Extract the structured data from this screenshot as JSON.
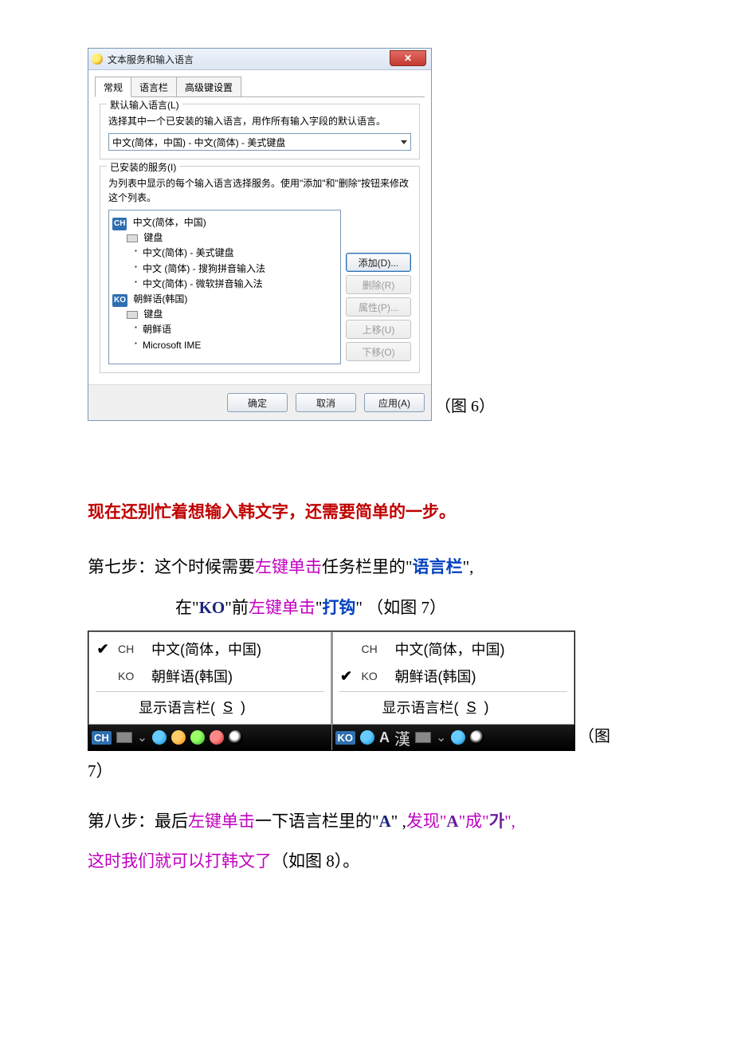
{
  "dialog": {
    "title": "文本服务和输入语言",
    "tabs": [
      "常规",
      "语言栏",
      "高级键设置"
    ],
    "group1": {
      "legend": "默认输入语言(L)",
      "desc": "选择其中一个已安装的输入语言，用作所有输入字段的默认语言。",
      "combo": "中文(简体，中国) - 中文(简体) - 美式键盘"
    },
    "group2": {
      "legend": "已安装的服务(I)",
      "desc": "为列表中显示的每个输入语言选择服务。使用\"添加\"和\"删除\"按钮来修改这个列表。",
      "tree": {
        "lang1": {
          "code": "CH",
          "name": "中文(简体，中国)",
          "kbd": "键盘",
          "items": [
            "中文(简体) - 美式键盘",
            "中文 (简体) - 搜狗拼音输入法",
            "中文(简体) - 微软拼音输入法"
          ]
        },
        "lang2": {
          "code": "KO",
          "name": "朝鲜语(韩国)",
          "kbd": "键盘",
          "items": [
            "朝鲜语",
            "Microsoft IME"
          ]
        }
      },
      "buttons": {
        "add": "添加(D)...",
        "remove": "删除(R)",
        "props": "属性(P)...",
        "up": "上移(U)",
        "down": "下移(O)"
      }
    },
    "footer": {
      "ok": "确定",
      "cancel": "取消",
      "apply": "应用(A)"
    }
  },
  "fig6_label": "（图 6）",
  "warning": "现在还别忙着想输入韩文字，还需要简单的一步。",
  "step7": {
    "prefix": "第七步：",
    "t1": "这个时候需要",
    "click": "左键单击",
    "t2": "任务栏里的\"",
    "langbar": "语言栏",
    "t3": "\",",
    "line2_a": "在\"",
    "ko": "KO",
    "line2_b": "\"前",
    "line2_c": "\"",
    "tick": "打钩",
    "line2_d": "\"   （如图 7）"
  },
  "fig7": {
    "left": {
      "rows": [
        {
          "checked": true,
          "code": "CH",
          "label": "中文(简体，中国)"
        },
        {
          "checked": false,
          "code": "KO",
          "label": "朝鲜语(韩国)"
        }
      ],
      "showbar_a": "显示语言栏(",
      "showbar_s": "S",
      "showbar_b": ")",
      "taskbar_badge": "CH"
    },
    "right": {
      "rows": [
        {
          "checked": false,
          "code": "CH",
          "label": "中文(简体，中国)"
        },
        {
          "checked": true,
          "code": "KO",
          "label": "朝鲜语(韩国)"
        }
      ],
      "showbar_a": "显示语言栏(",
      "showbar_s": "S",
      "showbar_b": ")",
      "taskbar_badge": "KO",
      "letter": "A",
      "han": "漢"
    }
  },
  "fig7_label_a": "（图",
  "fig7_label_b": "7）",
  "step8": {
    "prefix": "第八步：",
    "t1": "最后",
    "click": "左键单击",
    "t2": "一下语言栏里的\"",
    "A": "A",
    "t3": "\" ,",
    "discover_a": "发现\"",
    "A2": "A",
    "discover_b": "\"成\"",
    "ga": "가",
    "discover_c": "\",",
    "line2": "这时我们就可以打韩文了",
    "tail": "（如图 8）。"
  }
}
